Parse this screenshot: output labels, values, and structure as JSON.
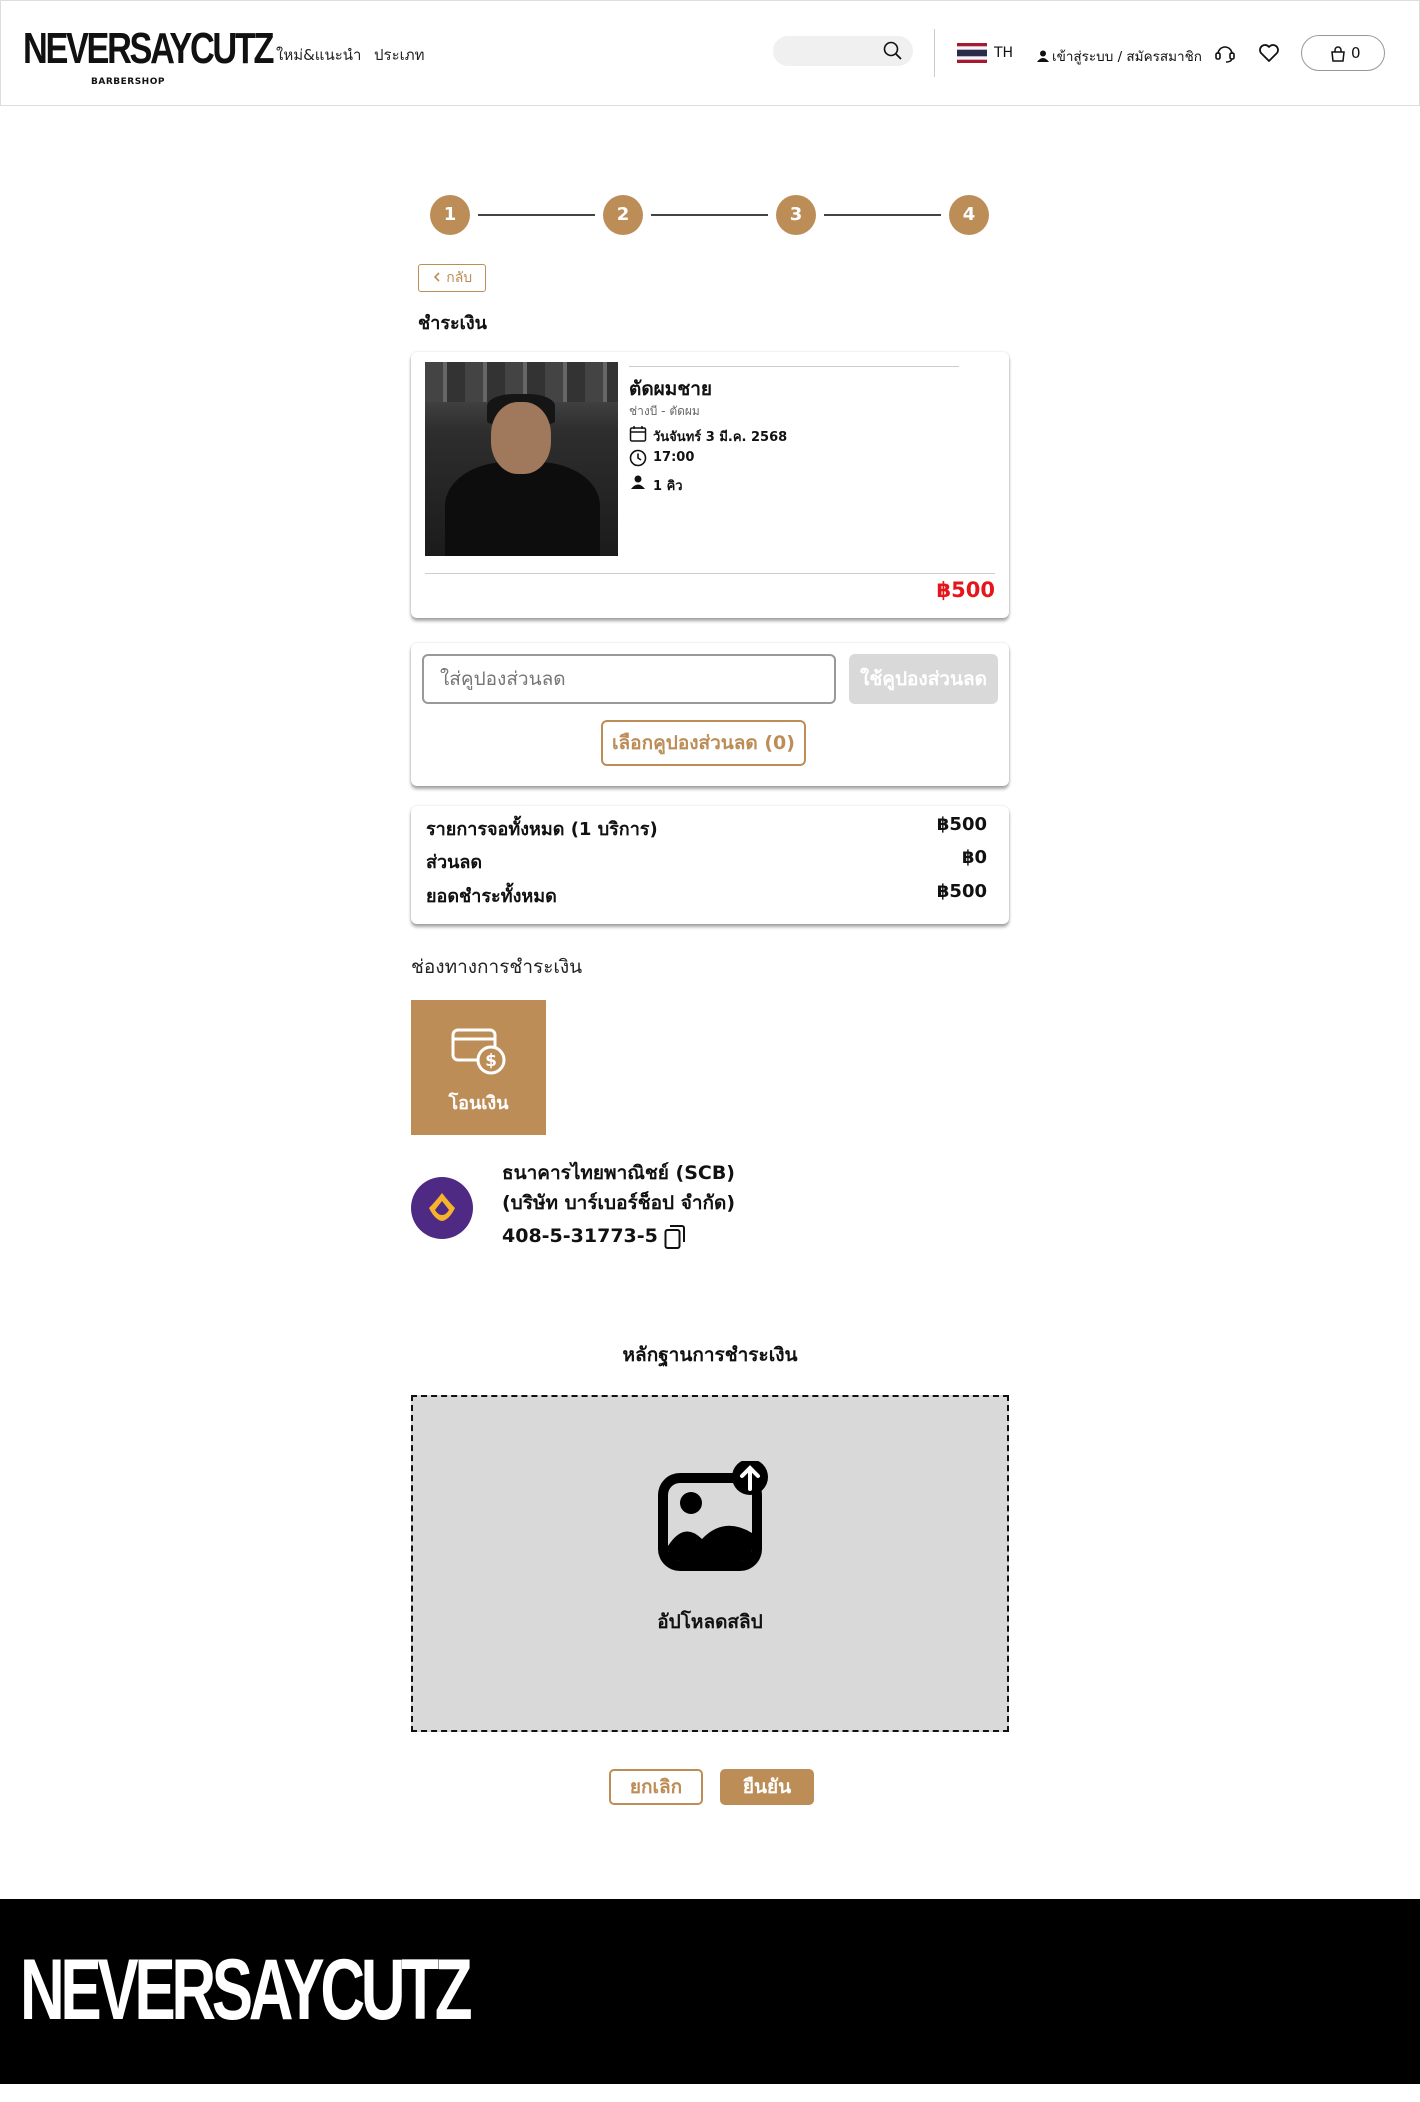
{
  "brand": {
    "logo_text": "NEVERSAYCUTZ",
    "logo_sub": "BARBERSHOP"
  },
  "header": {
    "nav": [
      "ใหม่&แนะนำ",
      "ประเภท"
    ],
    "search_placeholder": "",
    "lang": "TH",
    "login": "เข้าสู่ระบบ / สมัครสมาชิก",
    "cart_count": "0",
    "icons": [
      "search-icon",
      "thai-flag-icon",
      "user-icon",
      "support-icon",
      "heart-icon",
      "bag-icon"
    ]
  },
  "steps": [
    "1",
    "2",
    "3",
    "4"
  ],
  "back_label": "กลับ",
  "page_title": "ชำระเงิน",
  "service": {
    "name": "ตัดผมชาย",
    "sub": "ช่างบี - ตัดผม",
    "date": "วันจันทร์ 3 มี.ค. 2568",
    "time": "17:00",
    "queue": "1 คิว",
    "price": "฿500"
  },
  "coupon": {
    "placeholder": "ใส่คูปองส่วนลด",
    "apply_label": "ใช้คูปองส่วนลด",
    "select_label": "เลือกคูปองส่วนลด (0)"
  },
  "summary": {
    "rows": [
      {
        "label": "รายการจอทั้งหมด (1 บริการ)",
        "value": "฿500"
      },
      {
        "label": "ส่วนลด",
        "value": "฿0"
      },
      {
        "label": "ยอดชำระทั้งหมด",
        "value": "฿500"
      }
    ]
  },
  "payment": {
    "label": "ช่องทางการชำระเงิน",
    "method": "โอนเงิน",
    "bank_name": "ธนาคารไทยพาณิชย์ (SCB)",
    "account_name": "(บริษัท บาร์เบอร์ช็อป จำกัด)",
    "account_no": "408-5-31773-5"
  },
  "proof": {
    "title": "หลักฐานการชำระเงิน",
    "upload_label": "อัปโหลดสลิป"
  },
  "actions": {
    "cancel": "ยกเลิก",
    "confirm": "ยืนยัน"
  },
  "colors": {
    "accent": "#BD8D58",
    "price": "#E4161C",
    "bank": "#4E2A84",
    "footer": "#000000"
  }
}
